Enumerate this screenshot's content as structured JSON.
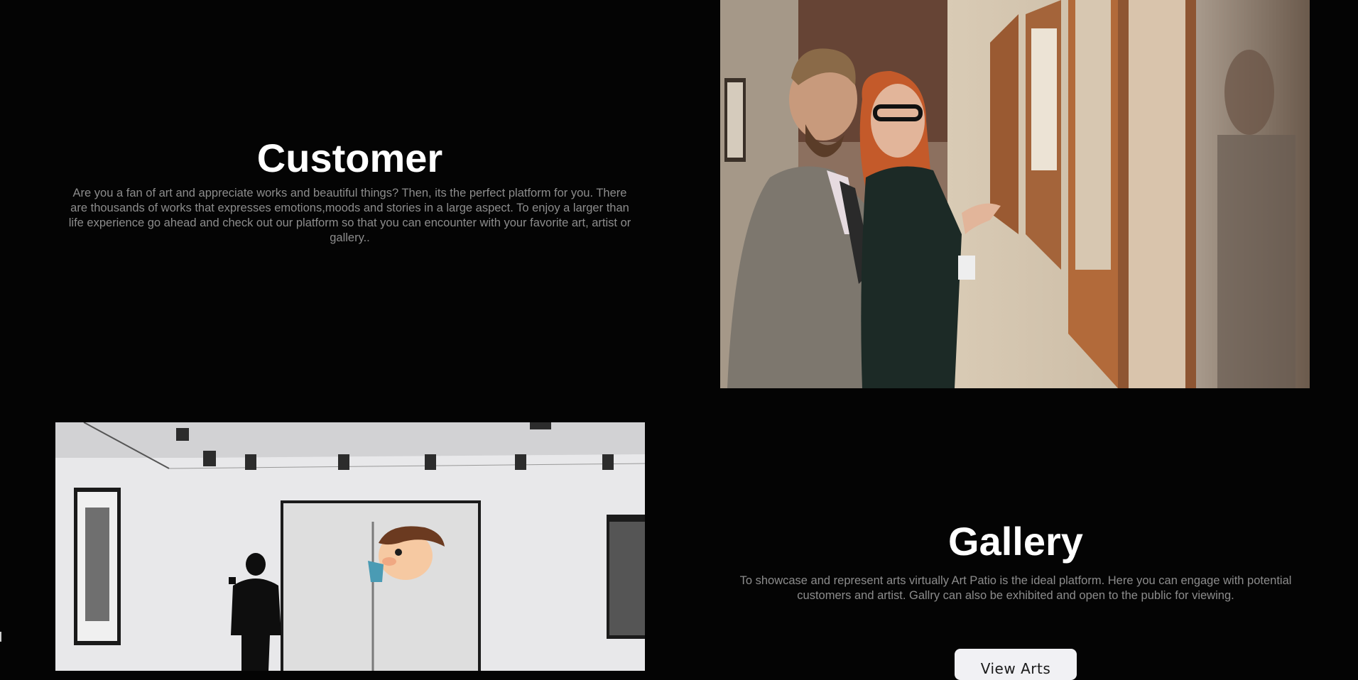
{
  "customer": {
    "title": "Customer",
    "description": "Are you a fan of art and appreciate works and beautiful things? Then, its the perfect platform for you. There are thousands of works that expresses emotions,moods and stories in a large aspect. To enjoy a larger than life experience go ahead and check out our platform so that you can encounter with your favorite art, artist or gallery.."
  },
  "gallery": {
    "title": "Gallery",
    "description": "To showcase and represent arts virtually Art Patio is the ideal platform. Here you can engage with potential customers and artist. Gallry can also be exhibited and open to the public for viewing.",
    "button_label": "View Arts"
  },
  "colors": {
    "background": "#040404",
    "heading": "#ffffff",
    "body_text": "#8c8c8c",
    "button_bg": "#f1f1f4"
  }
}
